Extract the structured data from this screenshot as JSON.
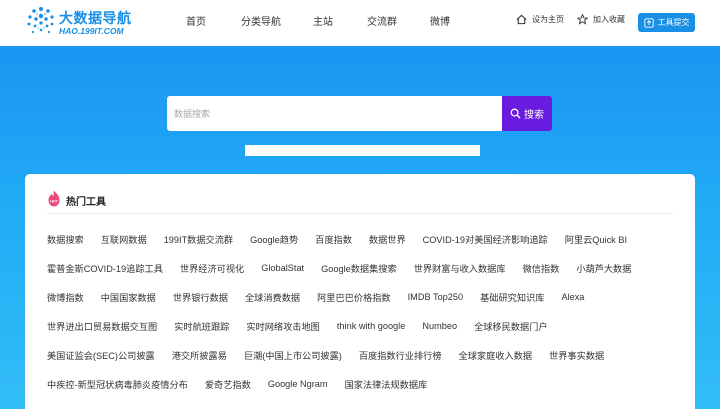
{
  "logo": {
    "title": "大数据导航",
    "subtitle": "HAO.199IT.COM"
  },
  "nav": [
    {
      "label": "首页"
    },
    {
      "label": "分类导航"
    },
    {
      "label": "主站"
    },
    {
      "label": "交流群"
    },
    {
      "label": "微博"
    }
  ],
  "header_links": {
    "set_home": "设为主页",
    "bookmark": "加入收藏",
    "submit_tool": "工具提交"
  },
  "search": {
    "placeholder": "数据搜索",
    "button_label": "搜索"
  },
  "hot_tools": {
    "title": "热门工具",
    "badge": "HOT",
    "rows": [
      [
        "数据搜索",
        "互联网数据",
        "199IT数据交流群",
        "Google趋势",
        "百度指数",
        "数据世界",
        "COVID-19对美国经济影响追踪",
        "阿里云Quick BI"
      ],
      [
        "霍普金斯COVID-19追踪工具",
        "世界经济可视化",
        "GlobalStat",
        "Google数据集搜索",
        "世界财富与收入数据库",
        "微信指数",
        "小葫芦大数据"
      ],
      [
        "微博指数",
        "中国国家数据",
        "世界银行数据",
        "全球消费数据",
        "阿里巴巴价格指数",
        "IMDB Top250",
        "基础研究知识库",
        "Alexa"
      ],
      [
        "世界进出口贸易数据交互图",
        "实时航班跟踪",
        "实时网络攻击地图",
        "think with google",
        "Numbeo",
        "全球移民数据门户"
      ],
      [
        "美国证监会(SEC)公司披露",
        "港交所披露易",
        "巨潮(中国上市公司披露)",
        "百度指数行业排行榜",
        "全球家庭收入数据",
        "世界事实数据"
      ],
      [
        "中疾控-新型冠状病毒肺炎疫情分布",
        "爱奇艺指数",
        "Google Ngram",
        "国家法律法规数据库"
      ]
    ]
  },
  "colors": {
    "brand_blue": "#1a8fe6",
    "search_button": "#6a1be0",
    "hot_badge": "#f0487a"
  }
}
